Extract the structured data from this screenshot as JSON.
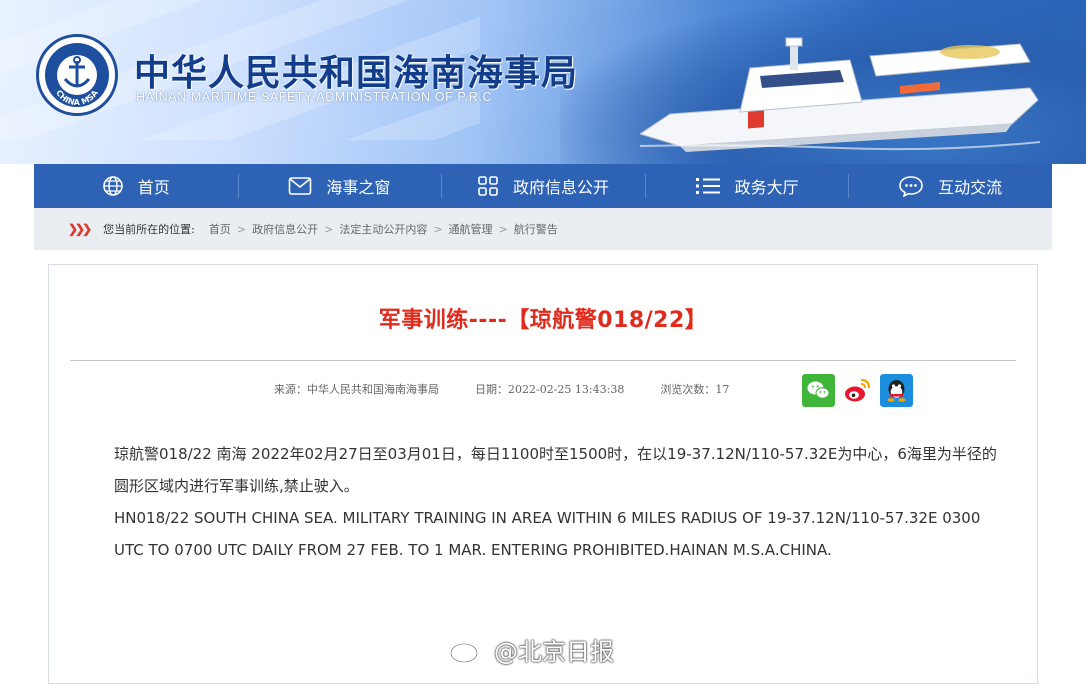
{
  "header": {
    "org_name_cn": "中华人民共和国海南海事局",
    "org_name_en": "HAINAN MARITIME SAFETY ADMINISTRATION OF P.R.C",
    "logo_text": "CHINA MSA"
  },
  "nav": [
    {
      "label": "首页",
      "icon": "globe-icon"
    },
    {
      "label": "海事之窗",
      "icon": "mail-icon"
    },
    {
      "label": "政府信息公开",
      "icon": "grid-icon"
    },
    {
      "label": "政务大厅",
      "icon": "list-icon"
    },
    {
      "label": "互动交流",
      "icon": "chat-icon"
    }
  ],
  "breadcrumb": {
    "prefix": "您当前所在的位置:",
    "items": [
      "首页",
      "政府信息公开",
      "法定主动公开内容",
      "通航管理",
      "航行警告"
    ],
    "separator": ">"
  },
  "article": {
    "title": "军事训练----【琼航警018/22】",
    "source": "来源：中华人民共和国海南海事局",
    "date": "日期：2022-02-25 13:43:38",
    "views": "浏览次数：17",
    "body_cn": "琼航警018/22 南海 2022年02月27日至03月01日，每日1100时至1500时，在以19-37.12N/110-57.32E为中心，6海里为半径的圆形区域内进行军事训练,禁止驶入。",
    "body_en": "HN018/22 SOUTH CHINA SEA. MILITARY TRAINING IN AREA WITHIN 6 MILES RADIUS OF 19-37.12N/110-57.32E 0300 UTC TO 0700 UTC DAILY FROM 27 FEB. TO 1 MAR. ENTERING PROHIBITED.HAINAN M.S.A.CHINA."
  },
  "share": [
    {
      "name": "wechat",
      "color": "#3fb63a"
    },
    {
      "name": "weibo",
      "color": "#e6162d"
    },
    {
      "name": "qq",
      "color": "#1b8ede"
    }
  ],
  "watermark": "@北京日报",
  "colors": {
    "nav_bg": "#2d62b4",
    "title_red": "#e02a1c",
    "breadcrumb_bg": "#eaeef3"
  }
}
